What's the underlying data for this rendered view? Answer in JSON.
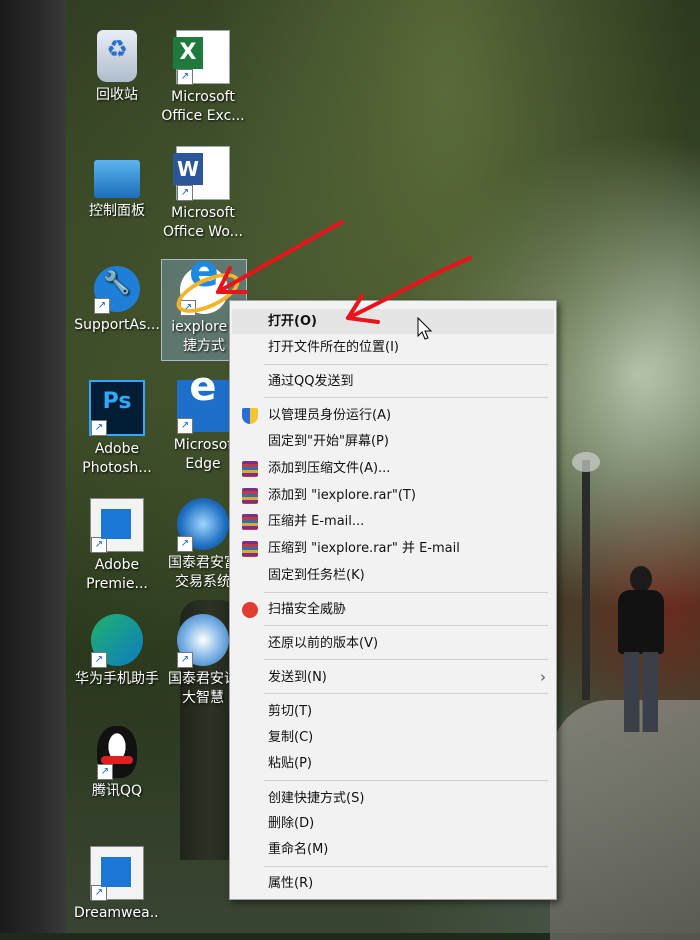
{
  "desktop": {
    "icons": [
      {
        "label": "回收站",
        "name": "recycle-bin"
      },
      {
        "label": "Microsoft Office Exc...",
        "name": "excel"
      },
      {
        "label": "控制面板",
        "name": "control-panel"
      },
      {
        "label": "Microsoft Office Wo...",
        "name": "word"
      },
      {
        "label": "SupportAs...",
        "name": "support-assistant"
      },
      {
        "label": "iexplore - 快捷方式",
        "name": "iexplore-shortcut"
      },
      {
        "label": "Adobe Photosh...",
        "name": "photoshop"
      },
      {
        "label": "Microsoft Edge",
        "name": "edge"
      },
      {
        "label": "Adobe Premie...",
        "name": "premiere"
      },
      {
        "label": "国泰君安富易交易系统",
        "name": "guotai-trading"
      },
      {
        "label": "华为手机助手",
        "name": "huawei-assistant"
      },
      {
        "label": "国泰君安证券大智慧",
        "name": "guotai-dzh"
      },
      {
        "label": "腾讯QQ",
        "name": "qq"
      },
      {
        "label": "Dreamwea...",
        "name": "dreamweaver"
      }
    ],
    "label_lines": {
      "excel": [
        "Microsoft",
        "Office Exc..."
      ],
      "word": [
        "Microsoft",
        "Office Wo..."
      ],
      "iexplore": [
        "iexplore -",
        "捷方式"
      ],
      "photoshop": [
        "Adobe",
        "Photosh..."
      ],
      "edge": [
        "Microsof",
        "Edge"
      ],
      "premiere": [
        "Adobe",
        "Premie..."
      ],
      "guotai": [
        "国泰君安富",
        "交易系统"
      ],
      "guotai2": [
        "国泰君安证",
        "大智慧"
      ]
    }
  },
  "context_menu": {
    "items": [
      {
        "label": "打开(O)",
        "bold": true
      },
      {
        "label": "打开文件所在的位置(I)"
      },
      {
        "label": "通过QQ发送到"
      },
      {
        "label": "以管理员身份运行(A)",
        "icon": "shield-icon"
      },
      {
        "label": "固定到\"开始\"屏幕(P)"
      },
      {
        "label": "添加到压缩文件(A)...",
        "icon": "winrar-icon"
      },
      {
        "label": "添加到 \"iexplore.rar\"(T)",
        "icon": "winrar-icon"
      },
      {
        "label": "压缩并 E-mail...",
        "icon": "winrar-icon"
      },
      {
        "label": "压缩到 \"iexplore.rar\" 并 E-mail",
        "icon": "winrar-icon"
      },
      {
        "label": "固定到任务栏(K)"
      },
      {
        "label": "扫描安全威胁",
        "icon": "security-scan-icon"
      },
      {
        "label": "还原以前的版本(V)"
      },
      {
        "label": "发送到(N)",
        "submenu": true
      },
      {
        "label": "剪切(T)"
      },
      {
        "label": "复制(C)"
      },
      {
        "label": "粘贴(P)"
      },
      {
        "label": "创建快捷方式(S)"
      },
      {
        "label": "删除(D)"
      },
      {
        "label": "重命名(M)"
      },
      {
        "label": "属性(R)"
      }
    ],
    "submenu_arrow": "›"
  },
  "colors": {
    "annotation_red": "#e8141a",
    "menu_bg": "#f2f2f2",
    "selection": "#8cb4dc"
  }
}
